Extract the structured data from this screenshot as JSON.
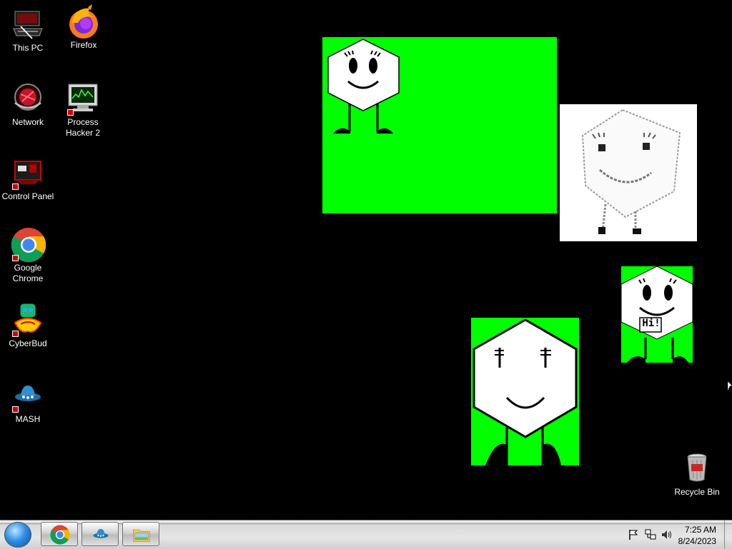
{
  "desktop": {
    "background": "#000000",
    "icons": [
      {
        "label_lines": [
          "This PC"
        ],
        "icon": "computer-icon"
      },
      {
        "label_lines": [
          "Firefox"
        ],
        "icon": "firefox-icon"
      },
      {
        "label_lines": [
          "Network"
        ],
        "icon": "network-icon"
      },
      {
        "label_lines": [
          "Process",
          "Hacker 2"
        ],
        "icon": "process-hacker-icon"
      },
      {
        "label_lines": [
          "Control Panel"
        ],
        "icon": "control-panel-icon"
      },
      {
        "label_lines": [
          "Google",
          "Chrome"
        ],
        "icon": "chrome-icon"
      },
      {
        "label_lines": [
          "CyberBud"
        ],
        "icon": "cyberbud-icon"
      },
      {
        "label_lines": [
          "MASH"
        ],
        "icon": "mash-icon"
      },
      {
        "label_lines": [
          "Recycle Bin"
        ],
        "icon": "recycle-bin-icon"
      }
    ]
  },
  "windows": {
    "character_greeting": "Hi!",
    "accent_green": "#00ff00"
  },
  "taskbar": {
    "pinned": [
      "chrome-icon",
      "mash-icon",
      "file-explorer-icon"
    ],
    "tray_icons": [
      "action-center-flag-icon",
      "network-icon",
      "volume-icon"
    ],
    "clock": {
      "time": "7:25 AM",
      "date": "8/24/2023"
    }
  }
}
